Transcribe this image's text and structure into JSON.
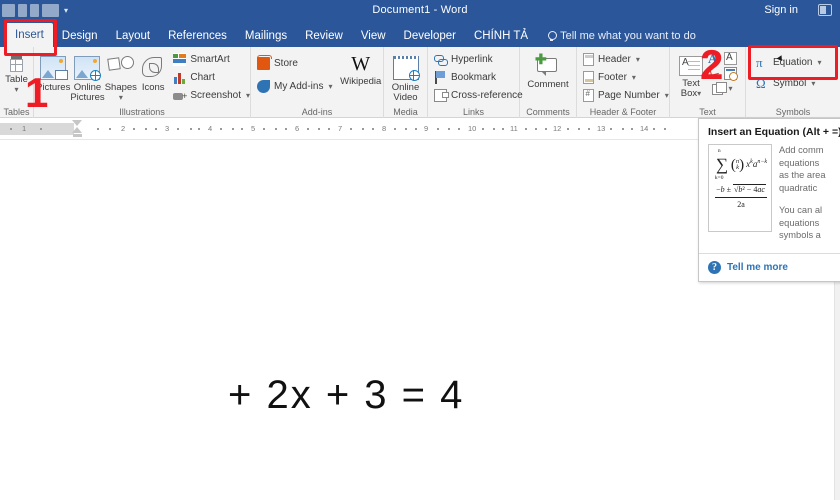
{
  "titlebar": {
    "document_title": "Document1  -  Word",
    "signin_label": "Sign in",
    "ribbon_display_icon": "ribbon-display-options-icon"
  },
  "tabs": [
    {
      "label": "Insert",
      "active": true
    },
    {
      "label": "Design",
      "active": false
    },
    {
      "label": "Layout",
      "active": false
    },
    {
      "label": "References",
      "active": false
    },
    {
      "label": "Mailings",
      "active": false
    },
    {
      "label": "Review",
      "active": false
    },
    {
      "label": "View",
      "active": false
    },
    {
      "label": "Developer",
      "active": false
    },
    {
      "label": "CHÍNH TẢ",
      "active": false
    }
  ],
  "tell_me": {
    "label": "Tell me what you want to do",
    "icon": "lightbulb-icon"
  },
  "ribbon": {
    "groups": [
      {
        "name": "Tables",
        "label": "Tables",
        "items": [
          {
            "label": "Table",
            "caret": "▾",
            "icon": "table-icon",
            "type": "big"
          }
        ]
      },
      {
        "name": "Illustrations",
        "label": "Illustrations",
        "items": [
          {
            "label": "Pictures",
            "icon": "pictures-icon",
            "type": "big"
          },
          {
            "label": "Online Pictures",
            "icon": "online-pictures-icon",
            "type": "big"
          },
          {
            "label": "Shapes",
            "caret": "▾",
            "icon": "shapes-icon",
            "type": "big"
          },
          {
            "label": "Icons",
            "icon": "icons-icon",
            "type": "big"
          },
          {
            "label": "SmartArt",
            "icon": "smartart-icon",
            "type": "small"
          },
          {
            "label": "Chart",
            "icon": "chart-icon",
            "type": "small"
          },
          {
            "label": "Screenshot",
            "caret": "▾",
            "icon": "screenshot-icon",
            "type": "small"
          }
        ]
      },
      {
        "name": "Add-ins",
        "label": "Add-ins",
        "items": [
          {
            "label": "Store",
            "icon": "store-icon",
            "type": "small"
          },
          {
            "label": "My Add-ins",
            "caret": "▾",
            "icon": "my-addins-icon",
            "type": "small"
          },
          {
            "label": "Wikipedia",
            "icon": "wikipedia-icon",
            "type": "big"
          }
        ]
      },
      {
        "name": "Media",
        "label": "Media",
        "items": [
          {
            "label": "Online Video",
            "icon": "online-video-icon",
            "type": "big"
          }
        ]
      },
      {
        "name": "Links",
        "label": "Links",
        "items": [
          {
            "label": "Hyperlink",
            "icon": "hyperlink-icon",
            "type": "small"
          },
          {
            "label": "Bookmark",
            "icon": "bookmark-icon",
            "type": "small"
          },
          {
            "label": "Cross-reference",
            "icon": "cross-reference-icon",
            "type": "small"
          }
        ]
      },
      {
        "name": "Comments",
        "label": "Comments",
        "items": [
          {
            "label": "Comment",
            "icon": "new-comment-icon",
            "type": "big"
          }
        ]
      },
      {
        "name": "HeaderFooter",
        "label": "Header & Footer",
        "items": [
          {
            "label": "Header",
            "caret": "▾",
            "icon": "header-icon",
            "type": "small"
          },
          {
            "label": "Footer",
            "caret": "▾",
            "icon": "footer-icon",
            "type": "small"
          },
          {
            "label": "Page Number",
            "caret": "▾",
            "icon": "page-number-icon",
            "type": "small"
          }
        ]
      },
      {
        "name": "Text",
        "label": "Text",
        "items": [
          {
            "label": "Text Box",
            "caret": "▾",
            "icon": "text-box-icon",
            "type": "big"
          },
          {
            "label": "WordArt",
            "icon": "wordart-icon",
            "type": "icononly"
          },
          {
            "label": "Drop Cap",
            "icon": "drop-cap-icon",
            "type": "icononly"
          },
          {
            "label": "Signature Line",
            "icon": "signature-line-icon",
            "type": "icononly"
          },
          {
            "label": "Date & Time",
            "icon": "date-time-icon",
            "type": "icononly"
          },
          {
            "label": "Object",
            "caret": "▾",
            "icon": "object-icon",
            "type": "icononly"
          }
        ]
      },
      {
        "name": "Symbols",
        "label": "Symbols",
        "items": [
          {
            "label": "Equation",
            "caret": "▾",
            "icon": "equation-pi-icon",
            "type": "small"
          },
          {
            "label": "Symbol",
            "caret": "▾",
            "icon": "symbol-omega-icon",
            "type": "small"
          }
        ]
      }
    ]
  },
  "annotations": [
    {
      "number": "1",
      "target": "insert-tab",
      "color": "#ee1c25"
    },
    {
      "number": "2",
      "target": "equation-button",
      "color": "#ee1c25"
    }
  ],
  "ruler": {
    "marks": [
      "1",
      "1",
      "2",
      "3",
      "4",
      "5",
      "6",
      "7",
      "8",
      "9",
      "10",
      "11",
      "12",
      "13",
      "14"
    ]
  },
  "document": {
    "equation_text": "+ 2x + 3 = 4"
  },
  "screentip": {
    "title": "Insert an Equation (Alt + =)",
    "paragraphs": [
      "Add common mathematical equations to your document, such as the area of a circle or a quadratic formula.",
      "You can also build your own equations using a library of math symbols and structures."
    ],
    "paragraph_lines": [
      [
        "Add comm",
        "equations",
        "as the area",
        "quadratic "
      ],
      [
        "You can al",
        "equations",
        "symbols a"
      ]
    ],
    "thumbnail": {
      "formula_top": "∑",
      "formula_sup": "n",
      "formula_sub": "k=0",
      "binom_n": "n",
      "binom_k": "k",
      "power_terms": "x  a",
      "fraction_numerator": "−b ± √b² − 4ac",
      "fraction_denominator": "2a"
    },
    "help_link": "Tell me more",
    "help_icon": "help-question-icon"
  },
  "colors": {
    "word_blue": "#2b579a",
    "ribbon_bg": "#f3f3f3",
    "annotation_red": "#ee1c25",
    "link_blue": "#2e74b5"
  }
}
